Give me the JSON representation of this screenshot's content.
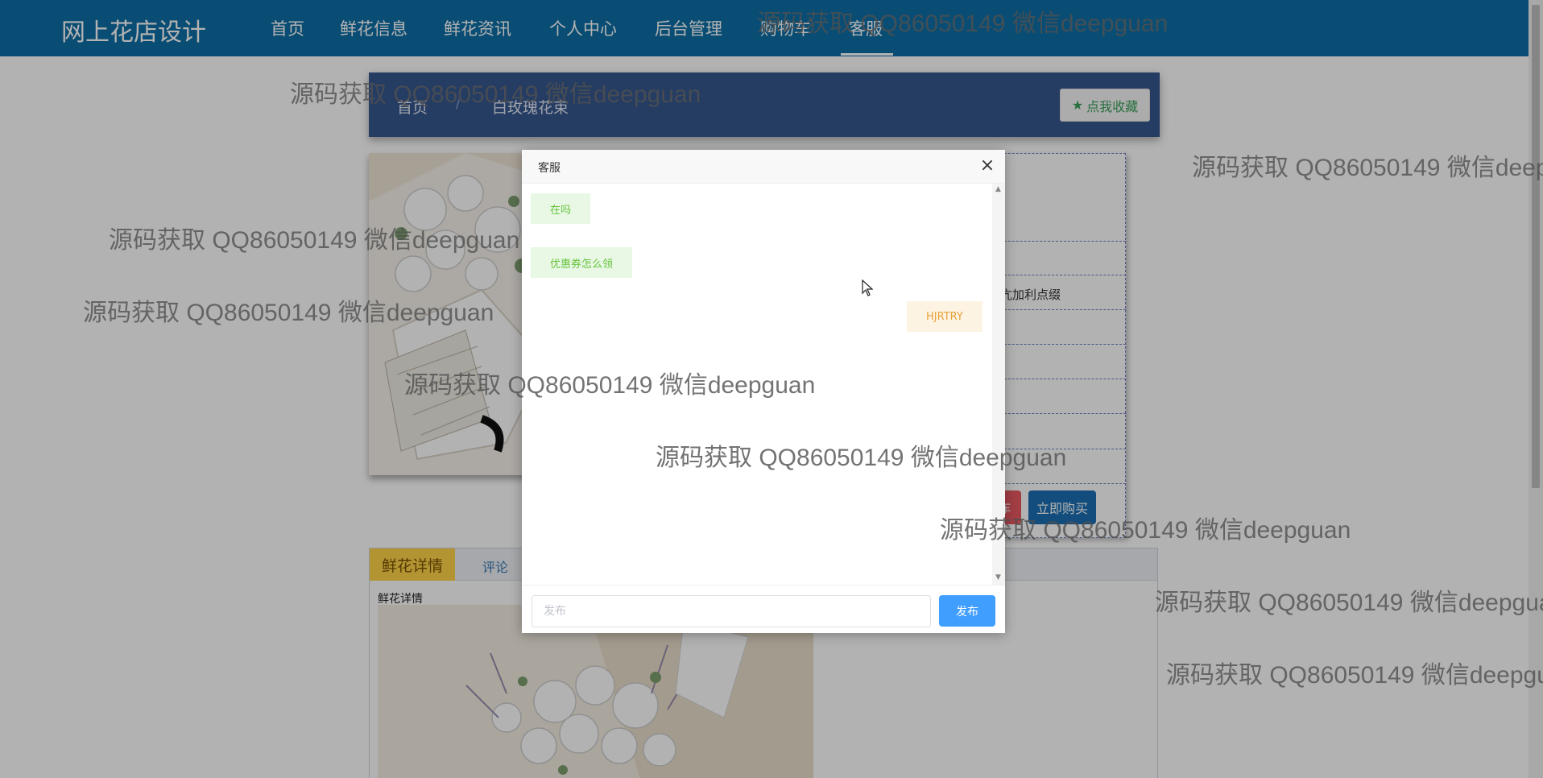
{
  "nav": {
    "brand": "网上花店设计",
    "items": [
      {
        "label": "首页"
      },
      {
        "label": "鲜花信息"
      },
      {
        "label": "鲜花资讯"
      },
      {
        "label": "个人中心"
      },
      {
        "label": "后台管理"
      },
      {
        "label": "购物车"
      },
      {
        "label": "客服"
      }
    ],
    "active": "客服"
  },
  "breadcrumb": {
    "home": "首页",
    "separator": "/",
    "current": "白玫瑰花束",
    "favorite_button": "点我收藏",
    "favorite_icon": "star-icon"
  },
  "product": {
    "info_snippet": "亢加利点缀",
    "red_button_label": "车",
    "buy_button": "立即购买"
  },
  "detail": {
    "tabs": [
      {
        "label": "鲜花详情"
      },
      {
        "label": "评论"
      }
    ],
    "active_tab": "鲜花详情",
    "section_label": "鲜花详情"
  },
  "chat_modal": {
    "title": "客服",
    "close_icon": "close-icon",
    "messages": [
      {
        "text": "在吗",
        "side": "left"
      },
      {
        "text": "优惠券怎么领",
        "side": "left"
      },
      {
        "text": "HJRTRY",
        "side": "right"
      }
    ],
    "input_placeholder": "发布",
    "input_value": "",
    "send_button": "发布"
  },
  "watermark_text": "源码获取 QQ86050149 微信deepguan",
  "colors": {
    "nav_bg": "#0e6fa6",
    "crumb_bg": "#35568f",
    "buy_button": "#1b6fb4",
    "send_button": "#409eff",
    "user_bubble_text": "#67c23a",
    "service_bubble_text": "#e6a23c",
    "active_tab": "#ffd54a"
  }
}
